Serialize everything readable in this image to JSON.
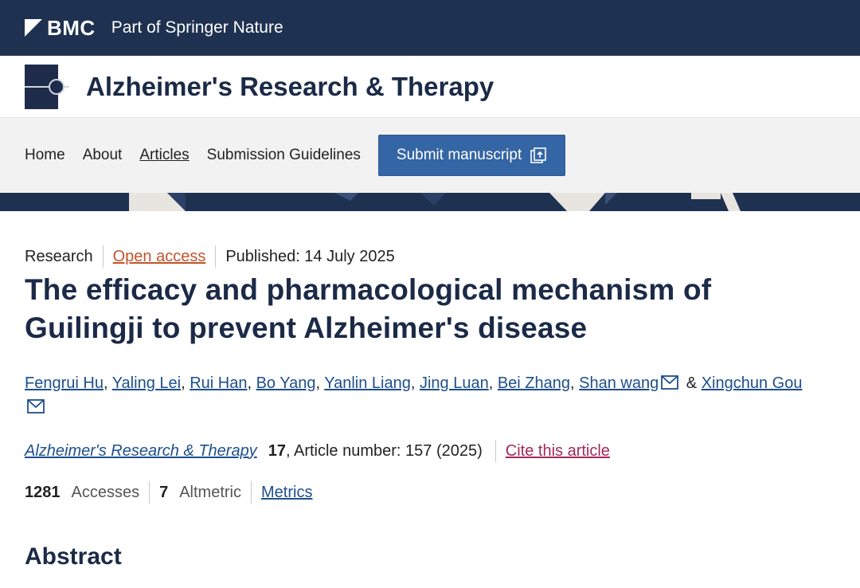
{
  "header": {
    "brand": "BMC",
    "tagline": "Part of Springer Nature"
  },
  "journal": {
    "title": "Alzheimer's Research & Therapy"
  },
  "nav": {
    "items": [
      {
        "label": "Home"
      },
      {
        "label": "About"
      },
      {
        "label": "Articles"
      },
      {
        "label": "Submission Guidelines"
      }
    ],
    "submit_label": "Submit manuscript"
  },
  "article": {
    "type": "Research",
    "access": "Open access",
    "published": "Published: 14 July 2025",
    "title_line1": "The efficacy and pharmacological mechanism of",
    "title_line2": "Guilingji to prevent Alzheimer's disease",
    "authors": [
      "Fengrui Hu",
      "Yaling Lei",
      "Rui Han",
      "Bo Yang",
      "Yanlin Liang",
      "Jing Luan",
      "Bei Zhang",
      "Shan wang",
      "Xingchun Gou"
    ],
    "author_amp": "&",
    "comma": ",",
    "citation": {
      "journal": "Alzheimer's Research & Therapy",
      "volume": "17",
      "rest": ", Article number: 157 (2025)",
      "cite_label": "Cite this article"
    },
    "metrics": {
      "accesses_value": "1281",
      "accesses_label": "Accesses",
      "altmetric_value": "7",
      "altmetric_label": "Altmetric",
      "metrics_link": "Metrics"
    }
  },
  "sections": {
    "abstract_heading": "Abstract"
  },
  "colors": {
    "topbar": "#1e3150",
    "button": "#3465a4",
    "link": "#1d4f8c",
    "open_access": "#c0542b",
    "cite": "#a3285a"
  }
}
